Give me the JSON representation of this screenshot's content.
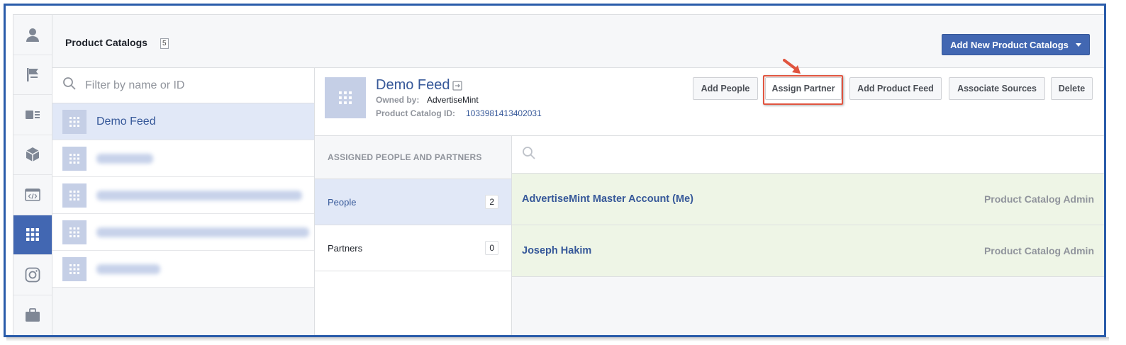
{
  "sidebar_icons": [
    "person-icon",
    "flag-icon",
    "ad-account-icon",
    "cube-icon",
    "code-icon",
    "catalog-grid-icon",
    "instagram-icon",
    "briefcase-icon"
  ],
  "header": {
    "title": "Product Catalogs",
    "count": "5",
    "add_button": "Add New Product Catalogs"
  },
  "list": {
    "filter_placeholder": "Filter by name or ID",
    "items": [
      {
        "name": "Demo Feed",
        "selected": true
      },
      {
        "name": "",
        "blurred": true
      },
      {
        "name": "",
        "blurred": true
      },
      {
        "name": "",
        "blurred": true
      },
      {
        "name": "",
        "blurred": true
      }
    ]
  },
  "detail": {
    "name": "Demo Feed",
    "owned_by_label": "Owned by:",
    "owned_by_value": "AdvertiseMint",
    "catalog_id_label": "Product Catalog ID:",
    "catalog_id_value": "1033981413402031",
    "buttons": {
      "add_people": "Add People",
      "assign_partner": "Assign Partner",
      "add_product_feed": "Add Product Feed",
      "associate_sources": "Associate Sources",
      "delete": "Delete"
    }
  },
  "assigned": {
    "header": "ASSIGNED PEOPLE AND PARTNERS",
    "tabs": [
      {
        "label": "People",
        "count": "2"
      },
      {
        "label": "Partners",
        "count": "0"
      }
    ]
  },
  "members": [
    {
      "name": "AdvertiseMint Master Account (Me)",
      "role": "Product Catalog Admin"
    },
    {
      "name": "Joseph Hakim",
      "role": "Product Catalog Admin"
    }
  ],
  "colors": {
    "accent": "#4267b2",
    "link": "#365899",
    "highlight": "#e0543f",
    "member_bg": "#eef5e6"
  }
}
